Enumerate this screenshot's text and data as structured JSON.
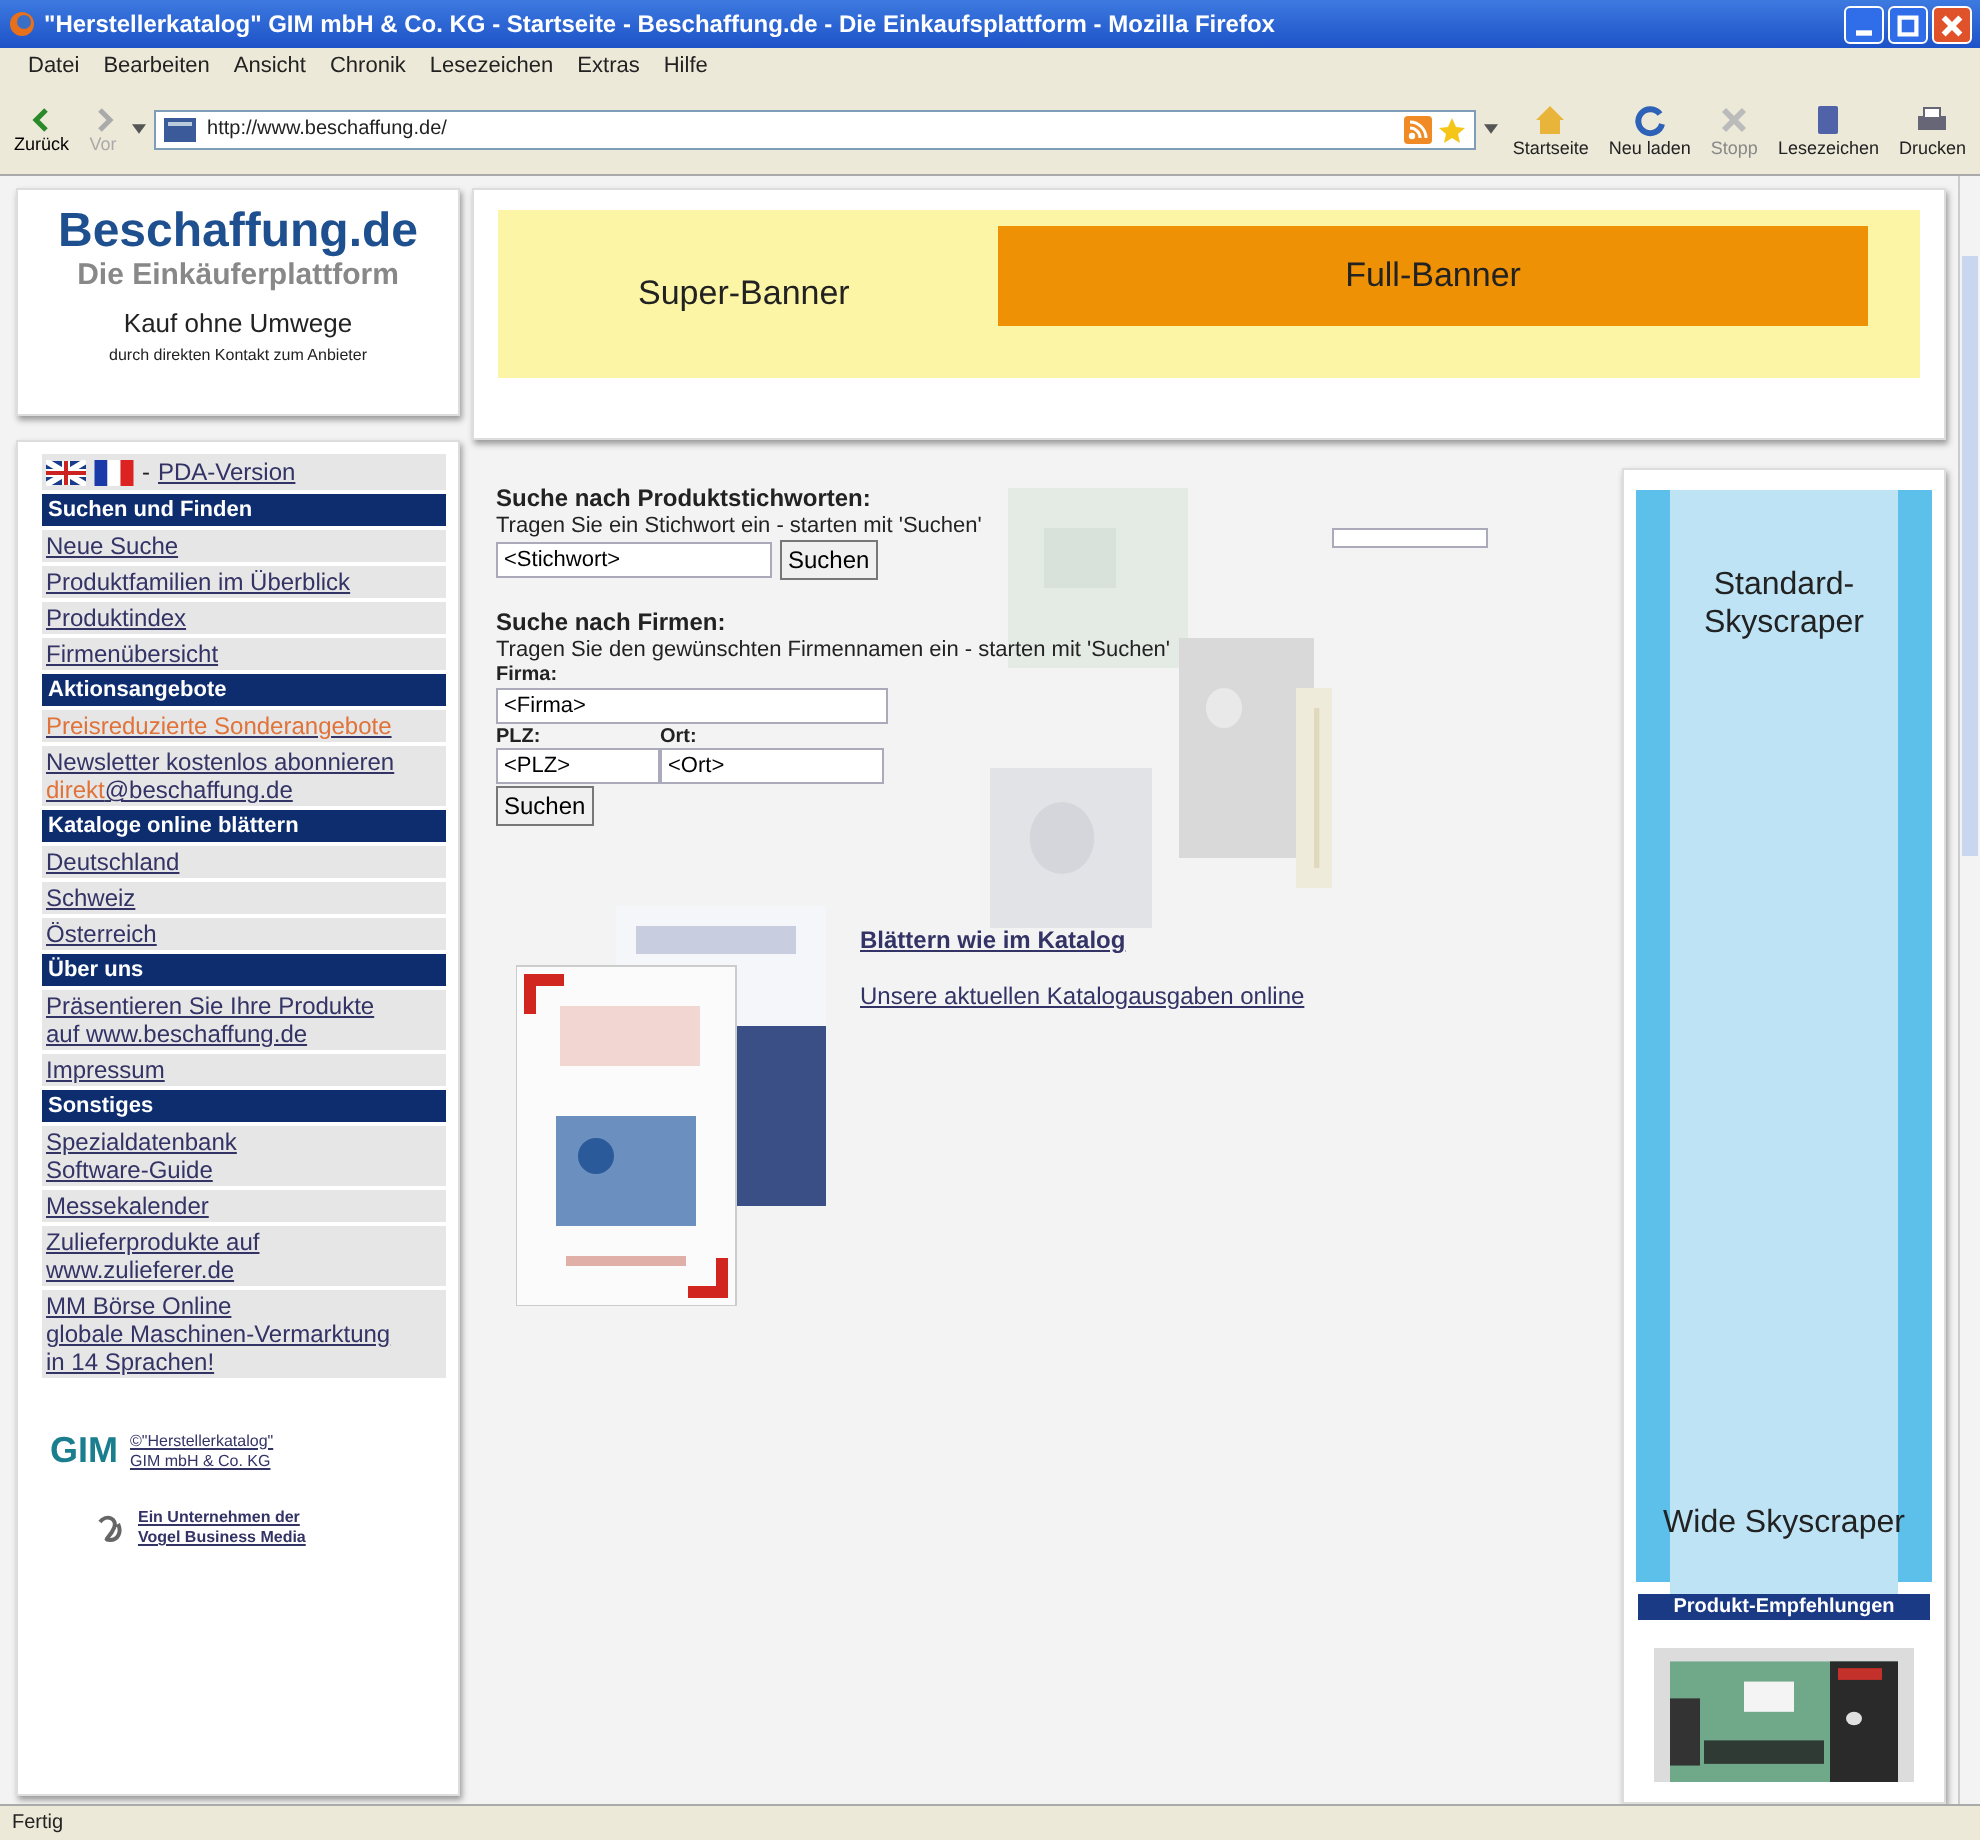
{
  "window": {
    "title": "\"Herstellerkatalog\" GIM mbH & Co. KG - Startseite - Beschaffung.de - Die Einkaufsplattform - Mozilla Firefox"
  },
  "menu": [
    "Datei",
    "Bearbeiten",
    "Ansicht",
    "Chronik",
    "Lesezeichen",
    "Extras",
    "Hilfe"
  ],
  "toolbar": {
    "back": "Zurück",
    "forward": "Vor",
    "address": "http://www.beschaffung.de/",
    "buttons": [
      {
        "kind": "home",
        "label": "Startseite",
        "disabled": false
      },
      {
        "kind": "reload",
        "label": "Neu laden",
        "disabled": false
      },
      {
        "kind": "stop",
        "label": "Stopp",
        "disabled": true
      },
      {
        "kind": "bookmarks",
        "label": "Lesezeichen",
        "disabled": false
      },
      {
        "kind": "print",
        "label": "Drucken",
        "disabled": false
      }
    ]
  },
  "logo": {
    "name": "Beschaffung.de",
    "tagline": "Die Einkäuferplattform",
    "slogan": "Kauf ohne Umwege",
    "subline": "durch direkten Kontakt zum Anbieter"
  },
  "banners": {
    "super": "Super-Banner",
    "full": "Full-Banner"
  },
  "sidebar": {
    "separator": "-",
    "pda": "PDA-Version",
    "sections": [
      {
        "title": "Suchen und Finden",
        "items": [
          {
            "lines": [
              [
                {
                  "text": "Neue Suche",
                  "highlighted": false
                }
              ]
            ]
          },
          {
            "lines": [
              [
                {
                  "text": "Produktfamilien im Überblick",
                  "highlighted": false
                }
              ]
            ]
          },
          {
            "lines": [
              [
                {
                  "text": "Produktindex",
                  "highlighted": false
                }
              ]
            ]
          },
          {
            "lines": [
              [
                {
                  "text": "Firmenübersicht",
                  "highlighted": false
                }
              ]
            ]
          }
        ]
      },
      {
        "title": "Aktionsangebote",
        "items": [
          {
            "lines": [
              [
                {
                  "text": "Preisreduzierte Sonderangebote",
                  "highlighted": true
                }
              ]
            ]
          },
          {
            "lines": [
              [
                {
                  "text": "Newsletter kostenlos abonnieren",
                  "highlighted": false
                }
              ],
              [
                {
                  "text": "direkt",
                  "highlighted": true
                },
                {
                  "text": "@beschaffung.de",
                  "highlighted": false
                }
              ]
            ]
          }
        ]
      },
      {
        "title": "Kataloge online blättern",
        "items": [
          {
            "lines": [
              [
                {
                  "text": "Deutschland",
                  "highlighted": false
                }
              ]
            ]
          },
          {
            "lines": [
              [
                {
                  "text": "Schweiz",
                  "highlighted": false
                }
              ]
            ]
          },
          {
            "lines": [
              [
                {
                  "text": "Österreich",
                  "highlighted": false
                }
              ]
            ]
          }
        ]
      },
      {
        "title": "Über uns",
        "items": [
          {
            "lines": [
              [
                {
                  "text": "Präsentieren Sie Ihre Produkte",
                  "highlighted": false
                }
              ],
              [
                {
                  "text": "auf www.beschaffung.de",
                  "highlighted": false
                }
              ]
            ]
          },
          {
            "lines": [
              [
                {
                  "text": "Impressum",
                  "highlighted": false
                }
              ]
            ]
          }
        ]
      },
      {
        "title": "Sonstiges",
        "items": [
          {
            "lines": [
              [
                {
                  "text": "Spezialdatenbank",
                  "highlighted": false
                }
              ],
              [
                {
                  "text": "Software-Guide",
                  "highlighted": false
                }
              ]
            ]
          },
          {
            "lines": [
              [
                {
                  "text": "Messekalender",
                  "highlighted": false
                }
              ]
            ]
          },
          {
            "lines": [
              [
                {
                  "text": "Zulieferprodukte auf",
                  "highlighted": false
                }
              ],
              [
                {
                  "text": "www.zulieferer.de",
                  "highlighted": false
                }
              ]
            ]
          },
          {
            "lines": [
              [
                {
                  "text": "MM Börse Online",
                  "highlighted": false
                }
              ],
              [
                {
                  "text": "globale Maschinen-Vermarktung",
                  "highlighted": false
                }
              ],
              [
                {
                  "text": "in 14 Sprachen!",
                  "highlighted": false
                }
              ]
            ]
          }
        ]
      }
    ],
    "footer": {
      "gim": "GIM",
      "gim_lines": [
        "©\"Herstellerkatalog\"",
        "GIM mbH & Co. KG"
      ],
      "vogel_lines": [
        "Ein Unternehmen der",
        "Vogel Business Media"
      ]
    }
  },
  "search": {
    "product": {
      "heading": "Suche nach Produktstichworten:",
      "hint": "Tragen Sie ein Stichwort ein - starten mit 'Suchen'",
      "keyword": "<Stichwort>",
      "button": "Suchen"
    },
    "company": {
      "heading": "Suche nach Firmen:",
      "hint": "Tragen Sie den gewünschten Firmennamen ein - starten mit 'Suchen'",
      "firm_label": "Firma:",
      "firm": "<Firma>",
      "zip_label": "PLZ:",
      "zip": "<PLZ>",
      "city_label": "Ort:",
      "city": "<Ort>",
      "button": "Suchen"
    }
  },
  "catalog": {
    "link": "Blättern wie im Katalog",
    "sublink": "Unsere aktuellen Katalogausgaben online"
  },
  "ads": {
    "standard": [
      "Standard-",
      "Skyscraper"
    ],
    "wide": "Wide Skyscraper",
    "recommend": "Produkt-Empfehlungen"
  },
  "status_bar": "Fertig"
}
